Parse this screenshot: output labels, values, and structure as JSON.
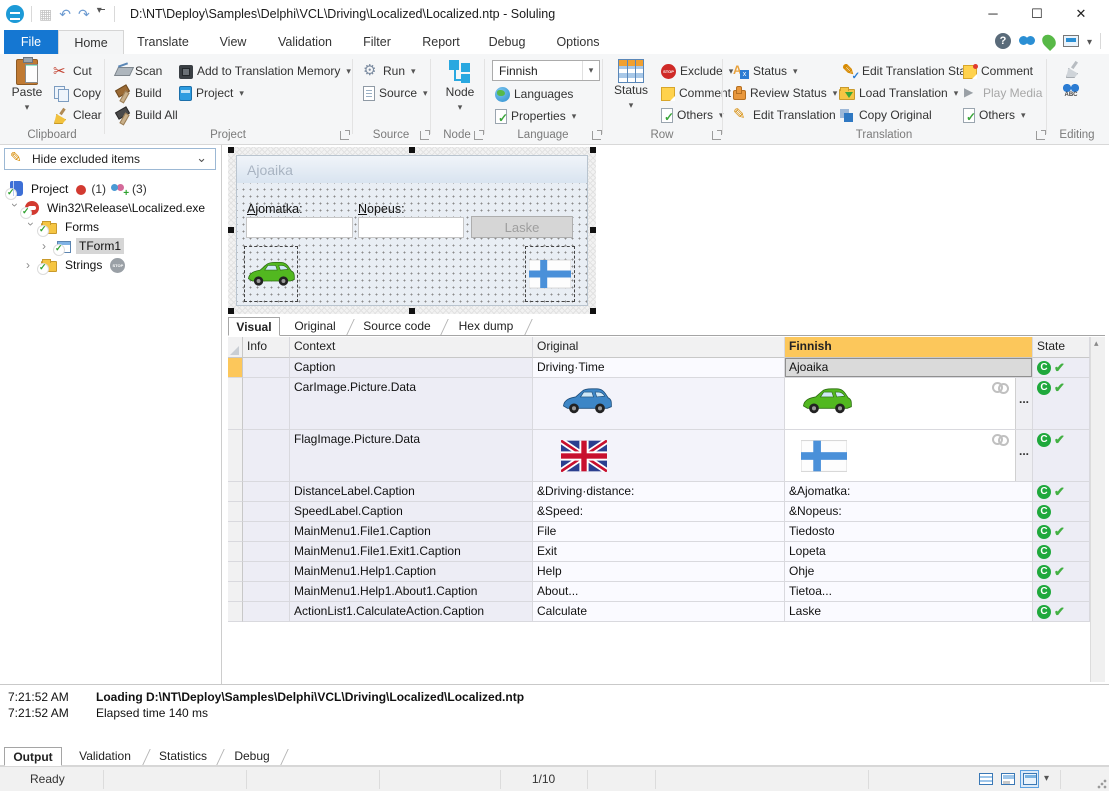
{
  "titlebar": {
    "title": "D:\\NT\\Deploy\\Samples\\Delphi\\VCL\\Driving\\Localized\\Localized.ntp - Soluling"
  },
  "ribbon": {
    "tabs": [
      "File",
      "Home",
      "Translate",
      "View",
      "Validation",
      "Filter",
      "Report",
      "Debug",
      "Options"
    ],
    "active_tab": "Home",
    "clipboard": {
      "label": "Clipboard",
      "paste": "Paste",
      "cut": "Cut",
      "copy": "Copy",
      "clear": "Clear"
    },
    "project": {
      "label": "Project",
      "scan": "Scan",
      "build": "Build",
      "build_all": "Build All",
      "add_to_tm": "Add to Translation Memory",
      "project": "Project"
    },
    "source": {
      "label": "Source",
      "run": "Run",
      "source": "Source"
    },
    "node": {
      "label": "Node",
      "node": "Node"
    },
    "language": {
      "label": "Language",
      "selected": "Finnish",
      "languages": "Languages",
      "properties": "Properties"
    },
    "row": {
      "label": "Row",
      "status": "Status",
      "exclude": "Exclude",
      "comment": "Comment",
      "others": "Others"
    },
    "translation": {
      "label": "Translation",
      "status": "Status",
      "review_status": "Review Status",
      "edit_translation": "Edit Translation",
      "edit_translation_state": "Edit Translation State",
      "load_translation": "Load Translation",
      "copy_original": "Copy Original",
      "comment": "Comment",
      "play_media": "Play Media",
      "others": "Others"
    },
    "editing": {
      "label": "Editing"
    }
  },
  "sidebar": {
    "filter": "Hide excluded items",
    "project_label": "Project",
    "project_badge1": "(1)",
    "project_badge2": "(3)",
    "exe_label": "Win32\\Release\\Localized.exe",
    "forms_label": "Forms",
    "form1_label": "TForm1",
    "strings_label": "Strings"
  },
  "preview": {
    "form_title": "Ajoaika",
    "distance_accel": "A",
    "distance_rest": "jomatka:",
    "speed_accel": "N",
    "speed_rest": "opeus:",
    "calc_button": "Laske"
  },
  "view_tabs": {
    "visual": "Visual",
    "original": "Original",
    "source_code": "Source code",
    "hex_dump": "Hex dump"
  },
  "grid": {
    "columns": {
      "info": "Info",
      "context": "Context",
      "original": "Original",
      "target": "Finnish",
      "state": "State"
    },
    "ellipsis": "...",
    "rows": [
      {
        "context": "Caption",
        "original": "Driving·Time",
        "target": "Ajoaika",
        "state": "C",
        "check": "✔"
      },
      {
        "context": "CarImage.Picture.Data",
        "original_image": "car-blue",
        "target_image": "car-green",
        "state": "C",
        "check": "✔"
      },
      {
        "context": "FlagImage.Picture.Data",
        "original_image": "flag-uk",
        "target_image": "flag-finland",
        "state": "C",
        "check": "✔"
      },
      {
        "context": "DistanceLabel.Caption",
        "original": "&Driving·distance:",
        "target": "&Ajomatka:",
        "state": "C",
        "check": "✔"
      },
      {
        "context": "SpeedLabel.Caption",
        "original": "&Speed:",
        "target": "&Nopeus:",
        "state": "C",
        "check": ""
      },
      {
        "context": "MainMenu1.File1.Caption",
        "original": "File",
        "target": "Tiedosto",
        "state": "C",
        "check": "✔"
      },
      {
        "context": "MainMenu1.File1.Exit1.Caption",
        "original": "Exit",
        "target": "Lopeta",
        "state": "C",
        "check": ""
      },
      {
        "context": "MainMenu1.Help1.Caption",
        "original": "Help",
        "target": "Ohje",
        "state": "C",
        "check": "✔"
      },
      {
        "context": "MainMenu1.Help1.About1.Caption",
        "original": "About...",
        "target": "Tietoa...",
        "state": "C",
        "check": ""
      },
      {
        "context": "ActionList1.CalculateAction.Caption",
        "original": "Calculate",
        "target": "Laske",
        "state": "C",
        "check": "✔"
      }
    ]
  },
  "output": {
    "tabs": {
      "output": "Output",
      "validation": "Validation",
      "statistics": "Statistics",
      "debug": "Debug"
    },
    "lines": [
      {
        "time": "7:21:52 AM",
        "message": "Loading D:\\NT\\Deploy\\Samples\\Delphi\\VCL\\Driving\\Localized\\Localized.ntp"
      },
      {
        "time": "7:21:52 AM",
        "message": "Elapsed time 140 ms"
      }
    ]
  },
  "statusbar": {
    "ready": "Ready",
    "position": "1/10"
  },
  "colors": {
    "accent_blue": "#1577d2",
    "target_header_orange": "#fcc75b",
    "state_green": "#1fa83c",
    "check_green": "#43b043"
  }
}
